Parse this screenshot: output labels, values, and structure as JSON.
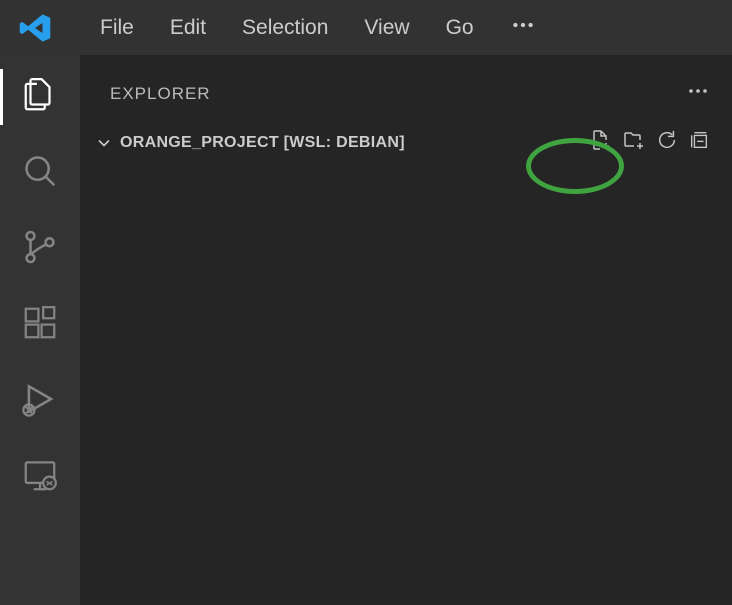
{
  "menu": {
    "items": [
      "File",
      "Edit",
      "Selection",
      "View",
      "Go"
    ]
  },
  "sidebar": {
    "title": "EXPLORER",
    "folder_label": "ORANGE_PROJECT [WSL: DEBIAN]"
  },
  "colors": {
    "annotation": "#3fa33f",
    "accent": "#279fed"
  },
  "icons": {
    "logo": "vscode-logo",
    "explorer": "files-icon",
    "search": "search-icon",
    "scm": "source-control-icon",
    "extensions": "extensions-icon",
    "debug": "run-debug-icon",
    "remote": "remote-explorer-icon",
    "chevron_down": "chevron-down-icon",
    "ellipsis": "ellipsis-icon",
    "new_file": "new-file-icon",
    "new_folder": "new-folder-icon",
    "refresh": "refresh-icon",
    "collapse": "collapse-all-icon"
  }
}
